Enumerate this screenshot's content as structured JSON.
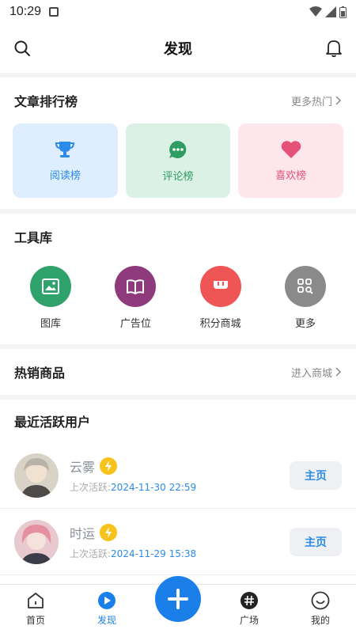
{
  "status_bar": {
    "time": "10:29"
  },
  "header": {
    "title": "发现"
  },
  "ranking": {
    "title": "文章排行榜",
    "more": "更多热门",
    "cards": [
      {
        "label": "阅读榜",
        "icon": "trophy-icon",
        "color": "#2a8bea"
      },
      {
        "label": "评论榜",
        "icon": "chat-icon",
        "color": "#2f9c63"
      },
      {
        "label": "喜欢榜",
        "icon": "heart-icon",
        "color": "#e4527a"
      }
    ]
  },
  "tools": {
    "title": "工具库",
    "items": [
      {
        "label": "图库",
        "icon": "image-icon",
        "color": "#2fa36b"
      },
      {
        "label": "广告位",
        "icon": "book-icon",
        "color": "#8e3a7c"
      },
      {
        "label": "积分商城",
        "icon": "store-icon",
        "color": "#ef5555"
      },
      {
        "label": "更多",
        "icon": "grid-search-icon",
        "color": "#8a8a8a"
      }
    ]
  },
  "hot_goods": {
    "title": "热销商品",
    "more": "进入商城"
  },
  "active_users": {
    "title": "最近活跃用户",
    "last_active_label": "上次活跃:",
    "users": [
      {
        "name": "云雾",
        "last_active": "2024-11-30 22:59",
        "button": "主页"
      },
      {
        "name": "时运",
        "last_active": "2024-11-29 15:38",
        "button": "主页"
      }
    ]
  },
  "bottom_nav": {
    "items": [
      {
        "label": "首页",
        "icon": "home-icon"
      },
      {
        "label": "发现",
        "icon": "discover-icon"
      },
      {
        "label": "广场",
        "icon": "hashtag-icon"
      },
      {
        "label": "我的",
        "icon": "profile-icon"
      }
    ],
    "active": "发现"
  },
  "colors": {
    "accent": "#1a7fe8",
    "bolt": "#f7c21a"
  }
}
